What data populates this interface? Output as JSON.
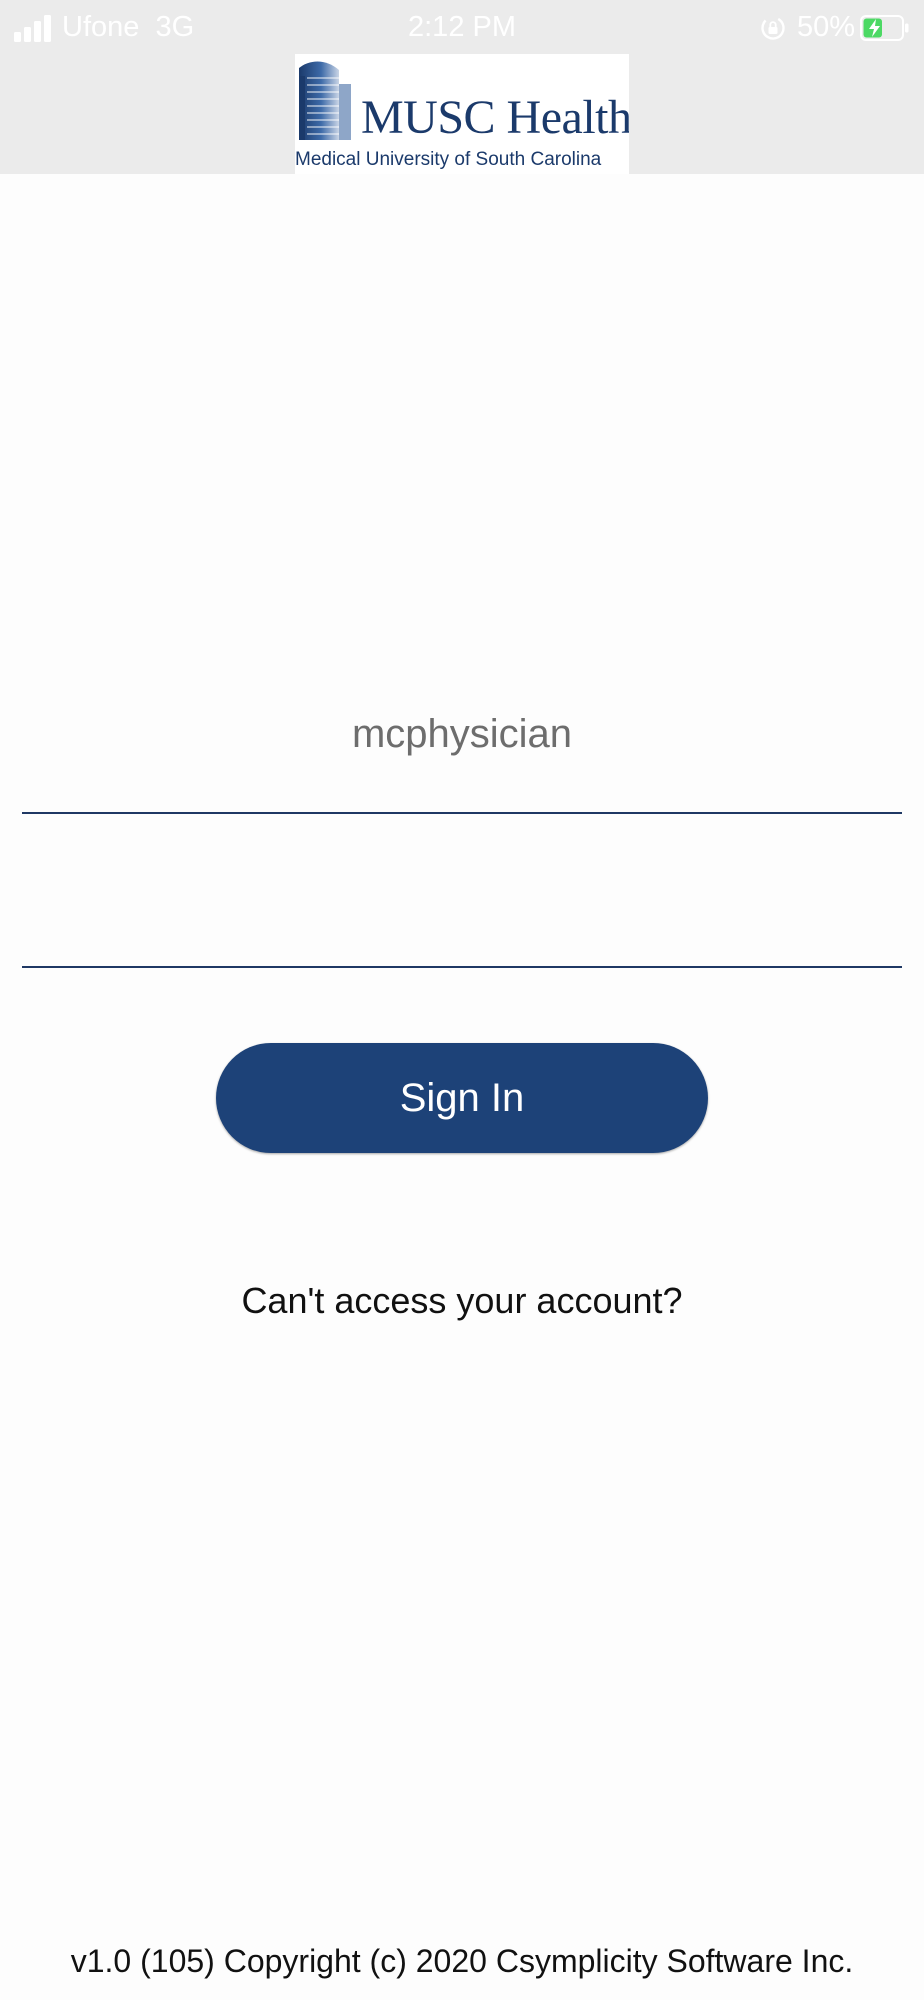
{
  "status_bar": {
    "carrier": "Ufone  3G",
    "time": "2:12 PM",
    "battery_percent": "50%",
    "signal_icon": "signal-bars-icon",
    "rotation_lock_icon": "rotation-lock-icon",
    "battery_icon": "battery-charging-icon",
    "battery_level": 0.5,
    "battery_color": "#4cd964"
  },
  "logo": {
    "name": "MUSC Health",
    "subtitle": "Medical University of South Carolina"
  },
  "login": {
    "username_value": "mcphysician",
    "password_value": "",
    "signin_label": "Sign In",
    "cant_access_label": "Can't access your account?"
  },
  "footer": {
    "copyright": "v1.0 (105) Copyright (c) 2020 Csymplicity Software Inc."
  },
  "colors": {
    "header_bg": "#ebebeb",
    "brand_navy": "#1d4278",
    "field_underline": "#1f3864",
    "page_bg": "#fdfdfd"
  }
}
